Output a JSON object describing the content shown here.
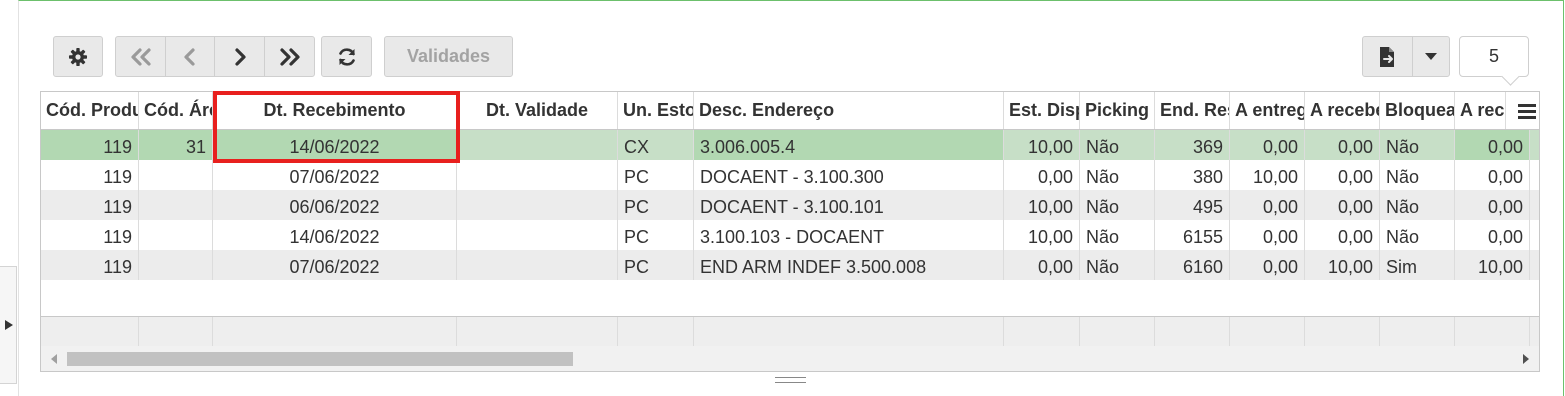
{
  "toolbar": {
    "validades_label": "Validades",
    "page_size": "5"
  },
  "grid": {
    "columns": [
      {
        "label": "Cód. Produto",
        "w": 98
      },
      {
        "label": "Cód. Área",
        "w": 74
      },
      {
        "label": "Dt. Recebimento",
        "w": 244
      },
      {
        "label": "Dt. Validade",
        "w": 161
      },
      {
        "label": "Un. Estoque",
        "w": 76
      },
      {
        "label": "Desc. Endereço",
        "w": 310
      },
      {
        "label": "Est. Disponível",
        "w": 76
      },
      {
        "label": "Picking",
        "w": 75
      },
      {
        "label": "End. Reserva",
        "w": 75
      },
      {
        "label": "A entregar",
        "w": 75
      },
      {
        "label": "A receber",
        "w": 75
      },
      {
        "label": "Bloqueado",
        "w": 75
      },
      {
        "label": "A receber",
        "w": 75
      }
    ],
    "rows": [
      [
        "119",
        "31",
        "14/06/2022",
        "",
        "CX",
        "3.006.005.4",
        "10,00",
        "Não",
        "369",
        "0,00",
        "0,00",
        "Não",
        "0,00"
      ],
      [
        "119",
        "",
        "07/06/2022",
        "",
        "PC",
        "DOCAENT - 3.100.300",
        "0,00",
        "Não",
        "380",
        "10,00",
        "0,00",
        "Não",
        "0,00"
      ],
      [
        "119",
        "",
        "06/06/2022",
        "",
        "PC",
        "DOCAENT - 3.100.101",
        "10,00",
        "Não",
        "495",
        "0,00",
        "0,00",
        "Não",
        "0,00"
      ],
      [
        "119",
        "",
        "14/06/2022",
        "",
        "PC",
        "3.100.103 - DOCAENT",
        "10,00",
        "Não",
        "6155",
        "0,00",
        "0,00",
        "Não",
        "0,00"
      ],
      [
        "119",
        "",
        "07/06/2022",
        "",
        "PC",
        "END ARM INDEF 3.500.008",
        "0,00",
        "Não",
        "6160",
        "0,00",
        "10,00",
        "Sim",
        "10,00"
      ]
    ],
    "align": [
      "r",
      "r",
      "c",
      "c",
      "l",
      "l",
      "r",
      "l",
      "r",
      "r",
      "r",
      "l",
      "r"
    ],
    "selected_row": 0,
    "colors": {
      "selected_row": "#c7dfc7",
      "selected_cells": "#b2d8b2",
      "stripe": "#ececec",
      "highlight_border": "#e8201e"
    }
  },
  "icons": [
    "gear-icon",
    "first-page-icon",
    "prev-page-icon",
    "next-page-icon",
    "last-page-icon",
    "refresh-icon",
    "export-icon",
    "dropdown-caret-icon",
    "column-menu-icon",
    "expand-panel-icon",
    "resize-grip-icon"
  ]
}
